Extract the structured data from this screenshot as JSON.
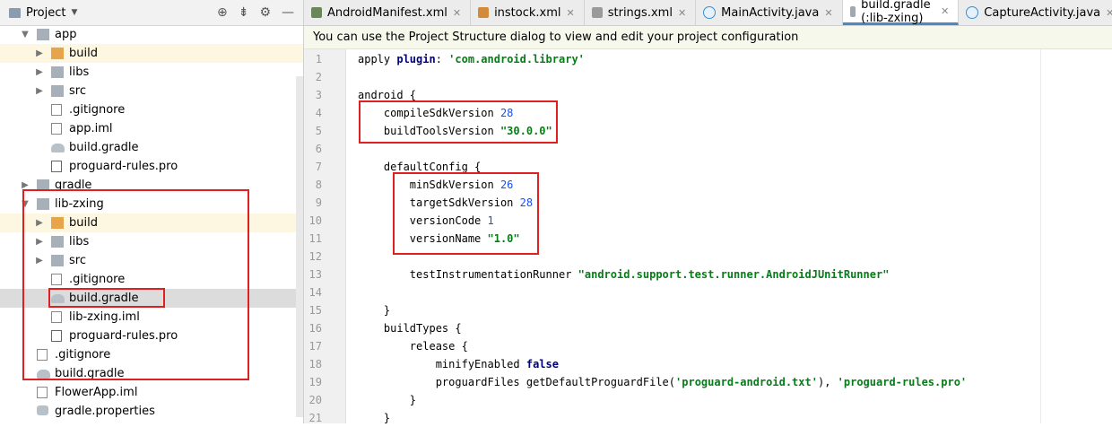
{
  "project_panel": {
    "title": "Project",
    "tree": [
      {
        "label": "app",
        "indent": 1,
        "arrow": "open",
        "icon": "module-folder-icon"
      },
      {
        "label": "build",
        "indent": 2,
        "arrow": "closed",
        "icon": "folder-icon",
        "highlight": true
      },
      {
        "label": "libs",
        "indent": 2,
        "arrow": "closed",
        "icon": "folder-icon"
      },
      {
        "label": "src",
        "indent": 2,
        "arrow": "closed",
        "icon": "folder-icon"
      },
      {
        "label": ".gitignore",
        "indent": 2,
        "icon": "gitignore-file-icon"
      },
      {
        "label": "app.iml",
        "indent": 2,
        "icon": "iml-file-icon"
      },
      {
        "label": "build.gradle",
        "indent": 2,
        "icon": "gradle-file-icon"
      },
      {
        "label": "proguard-rules.pro",
        "indent": 2,
        "icon": "text-file-icon"
      },
      {
        "label": "gradle",
        "indent": 1,
        "arrow": "closed",
        "icon": "folder-icon"
      },
      {
        "label": "lib-zxing",
        "indent": 1,
        "arrow": "open",
        "icon": "library-module-icon"
      },
      {
        "label": "build",
        "indent": 2,
        "arrow": "closed",
        "icon": "folder-icon",
        "highlight": true
      },
      {
        "label": "libs",
        "indent": 2,
        "arrow": "closed",
        "icon": "folder-icon"
      },
      {
        "label": "src",
        "indent": 2,
        "arrow": "closed",
        "icon": "folder-icon"
      },
      {
        "label": ".gitignore",
        "indent": 2,
        "icon": "gitignore-file-icon"
      },
      {
        "label": "build.gradle",
        "indent": 2,
        "icon": "gradle-file-icon",
        "selected": true
      },
      {
        "label": "lib-zxing.iml",
        "indent": 2,
        "icon": "iml-file-icon"
      },
      {
        "label": "proguard-rules.pro",
        "indent": 2,
        "icon": "text-file-icon"
      },
      {
        "label": ".gitignore",
        "indent": 1,
        "icon": "gitignore-file-icon"
      },
      {
        "label": "build.gradle",
        "indent": 1,
        "icon": "gradle-file-icon"
      },
      {
        "label": "FlowerApp.iml",
        "indent": 1,
        "icon": "iml-file-icon"
      },
      {
        "label": "gradle.properties",
        "indent": 1,
        "icon": "gradle-properties-icon"
      }
    ]
  },
  "tabs": [
    {
      "label": "AndroidManifest.xml",
      "icon": "manifest-icon",
      "active": false
    },
    {
      "label": "instock.xml",
      "icon": "xml-file-icon",
      "active": false
    },
    {
      "label": "strings.xml",
      "icon": "xml-strings-icon",
      "active": false
    },
    {
      "label": "MainActivity.java",
      "icon": "java-class-icon",
      "active": false
    },
    {
      "label": "build.gradle (:lib-zxing)",
      "icon": "gradle-file-icon",
      "active": true
    },
    {
      "label": "CaptureActivity.java",
      "icon": "java-class-icon",
      "active": false
    }
  ],
  "banner": "You can use the Project Structure dialog to view and edit your project configuration",
  "code_lines": [
    [
      {
        "t": "apply ",
        "c": "fn"
      },
      {
        "t": "plugin",
        "c": "kw"
      },
      {
        "t": ": ",
        "c": "fn"
      },
      {
        "t": "'com.android.library'",
        "c": "str"
      }
    ],
    [],
    [
      {
        "t": "android {",
        "c": "fn"
      }
    ],
    [
      {
        "t": "    compileSdkVersion ",
        "c": "fn"
      },
      {
        "t": "28",
        "c": "num"
      }
    ],
    [
      {
        "t": "    buildToolsVersion ",
        "c": "fn"
      },
      {
        "t": "\"30.0.0\"",
        "c": "str"
      }
    ],
    [],
    [
      {
        "t": "    defaultConfig {",
        "c": "fn"
      }
    ],
    [
      {
        "t": "        minSdkVersion ",
        "c": "fn"
      },
      {
        "t": "26",
        "c": "num"
      }
    ],
    [
      {
        "t": "        targetSdkVersion ",
        "c": "fn"
      },
      {
        "t": "28",
        "c": "num"
      }
    ],
    [
      {
        "t": "        versionCode ",
        "c": "fn"
      },
      {
        "t": "1",
        "c": "num"
      }
    ],
    [
      {
        "t": "        versionName ",
        "c": "fn"
      },
      {
        "t": "\"1.0\"",
        "c": "str"
      }
    ],
    [],
    [
      {
        "t": "        testInstrumentationRunner ",
        "c": "fn"
      },
      {
        "t": "\"android.support.test.runner.AndroidJUnitRunner\"",
        "c": "str"
      }
    ],
    [],
    [
      {
        "t": "    }",
        "c": "fn"
      }
    ],
    [
      {
        "t": "    buildTypes {",
        "c": "fn"
      }
    ],
    [
      {
        "t": "        release {",
        "c": "fn"
      }
    ],
    [
      {
        "t": "            minifyEnabled ",
        "c": "fn"
      },
      {
        "t": "false",
        "c": "kw"
      }
    ],
    [
      {
        "t": "            proguardFiles getDefaultProguardFile(",
        "c": "fn"
      },
      {
        "t": "'proguard-android.txt'",
        "c": "str"
      },
      {
        "t": "), ",
        "c": "fn"
      },
      {
        "t": "'proguard-rules.pro'",
        "c": "str"
      }
    ],
    [
      {
        "t": "        }",
        "c": "fn"
      }
    ],
    [
      {
        "t": "    }",
        "c": "fn"
      }
    ]
  ],
  "colors": {
    "accent": "#4a88c7",
    "annotation": "#e02020",
    "string": "#067d17",
    "number": "#1750eb",
    "keyword": "#000080"
  }
}
